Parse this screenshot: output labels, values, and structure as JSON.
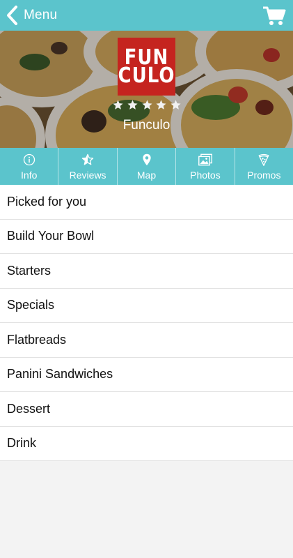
{
  "header": {
    "back_label": "Menu",
    "back_icon": "chevron-left-icon",
    "cart_icon": "cart-icon",
    "bar_color": "#5bc4cc"
  },
  "restaurant": {
    "logo_lines": [
      "FUN",
      "CULO"
    ],
    "logo_color": "#c5241f",
    "rating": 5,
    "max_rating": 5,
    "name": "Funculo"
  },
  "tabs": [
    {
      "label": "Info",
      "icon": "info-icon"
    },
    {
      "label": "Reviews",
      "icon": "star-half-icon"
    },
    {
      "label": "Map",
      "icon": "map-pin-icon"
    },
    {
      "label": "Photos",
      "icon": "photos-icon"
    },
    {
      "label": "Promos",
      "icon": "pizza-slice-icon"
    }
  ],
  "menu": {
    "categories": [
      "Picked for you",
      "Build Your Bowl",
      "Starters",
      "Specials",
      "Flatbreads",
      "Panini Sandwiches",
      "Dessert",
      "Drink"
    ]
  }
}
